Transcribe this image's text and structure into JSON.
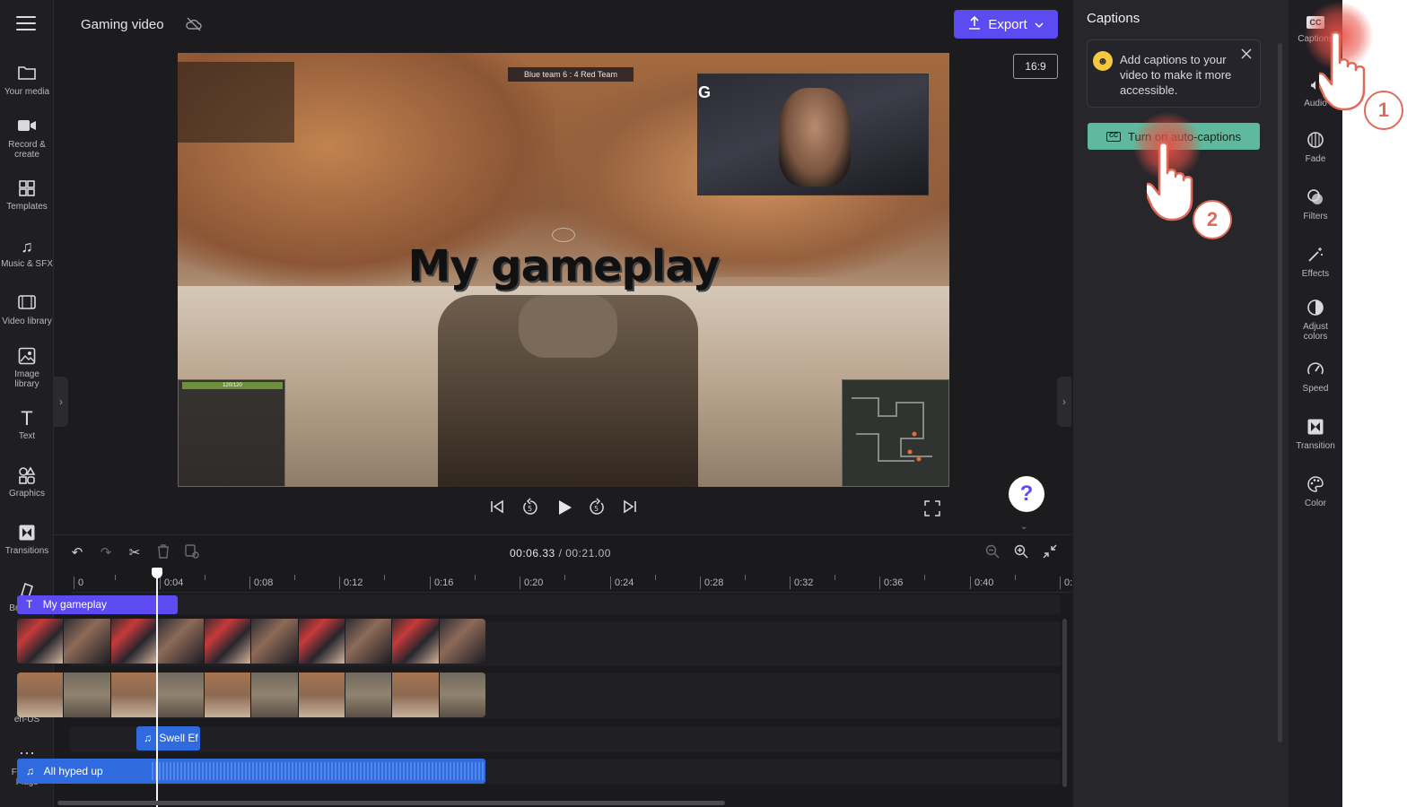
{
  "topbar": {
    "title": "Gaming video",
    "export_label": "Export",
    "aspect_ratio": "16:9"
  },
  "leftnav": {
    "items": [
      {
        "label": "Your media",
        "icon": "folder-icon"
      },
      {
        "label": "Record & create",
        "icon": "camera-icon"
      },
      {
        "label": "Templates",
        "icon": "templates-icon"
      },
      {
        "label": "Music & SFX",
        "icon": "music-icon"
      },
      {
        "label": "Video library",
        "icon": "film-icon"
      },
      {
        "label": "Image library",
        "icon": "image-icon"
      },
      {
        "label": "Text",
        "icon": "text-icon"
      },
      {
        "label": "Graphics",
        "icon": "graphics-icon"
      },
      {
        "label": "Transitions",
        "icon": "transitions-icon"
      },
      {
        "label": "Brand kit",
        "icon": "brand-kit-icon"
      },
      {
        "label": "en-US",
        "icon": "language-icon"
      },
      {
        "label": "Feature Flags",
        "icon": "more-icon"
      }
    ]
  },
  "preview": {
    "overlay_text": "My gameplay",
    "score_text": "Blue team 6 : 4  Red Team",
    "ammo_bar_text": "120/120"
  },
  "timeline": {
    "current_time": "00:06.33",
    "total_time": "/ 00:21.00",
    "ruler": [
      "0",
      "0:04",
      "0:08",
      "0:12",
      "0:16",
      "0:20",
      "0:24",
      "0:28",
      "0:32",
      "0:36",
      "0:40",
      "0:"
    ],
    "text_clip": "My gameplay",
    "sfx_clip": "Swell Ef",
    "audio_clip": "All hyped up"
  },
  "captions": {
    "title": "Captions",
    "card_text": "Add captions to your video to make it more accessible.",
    "button_label": "Turn on auto-captions",
    "cc_label": "CC"
  },
  "rightrail": {
    "items": [
      {
        "label": "Captions",
        "icon": "captions-icon"
      },
      {
        "label": "Audio",
        "icon": "audio-icon"
      },
      {
        "label": "Fade",
        "icon": "fade-icon"
      },
      {
        "label": "Filters",
        "icon": "filters-icon"
      },
      {
        "label": "Effects",
        "icon": "effects-icon"
      },
      {
        "label": "Adjust colors",
        "icon": "adjust-colors-icon"
      },
      {
        "label": "Speed",
        "icon": "speed-icon"
      },
      {
        "label": "Transition",
        "icon": "transition-icon"
      },
      {
        "label": "Color",
        "icon": "color-icon"
      }
    ]
  },
  "tutorial": {
    "step1": "1",
    "step2": "2"
  },
  "help": "?",
  "colors": {
    "accent": "#5b4bf0",
    "captions_button": "#5fb99c",
    "audio_clip": "#2f6bdf",
    "highlight": "#e8504f"
  }
}
